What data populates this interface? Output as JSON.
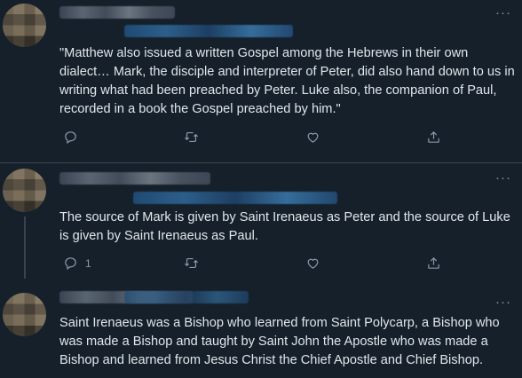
{
  "tweets": [
    {
      "text": "\"Matthew also issued a written Gospel among the Hebrews in their own dialect… Mark, the disciple and interpreter of Peter, did also hand down to us in writing what had been preached by Peter. Luke also, the companion of Paul, recorded in a book the Gospel preached by him.\"",
      "reply_count": "",
      "more_label": "···"
    },
    {
      "text": "The source of Mark is given by Saint Irenaeus as Peter and the source of Luke is given by Saint Irenaeus as Paul.",
      "reply_count": "1",
      "more_label": "···"
    },
    {
      "text": "Saint Irenaeus was a Bishop who learned from Saint Polycarp, a Bishop who was made a Bishop and taught by Saint John the Apostle who was made a Bishop and learned from Jesus Christ the Chief Apostle and Chief Bishop.",
      "more_label": "···"
    }
  ],
  "icons": {
    "reply": "reply-icon",
    "retweet": "retweet-icon",
    "like": "like-icon",
    "share": "share-icon",
    "more": "more-icon"
  },
  "colors": {
    "background": "#15202b",
    "text": "#e1e6ea",
    "muted": "#8b98a5",
    "separator": "#38444d"
  }
}
